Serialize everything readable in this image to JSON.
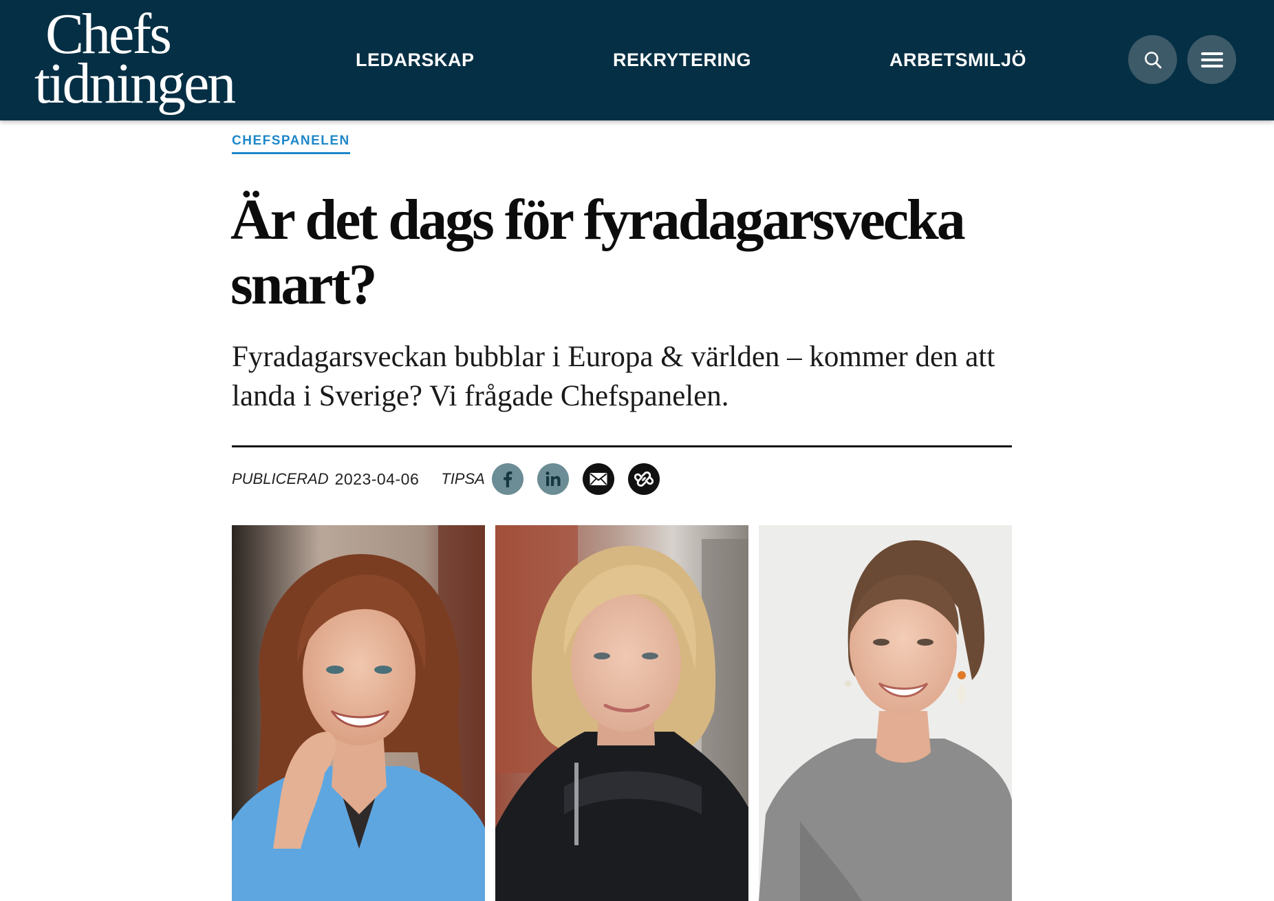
{
  "header": {
    "logo": {
      "line1": "Chefs",
      "line2": "tidningen"
    },
    "nav": [
      {
        "label": "LEDARSKAP"
      },
      {
        "label": "REKRYTERING"
      },
      {
        "label": "ARBETSMILJÖ"
      }
    ],
    "buttons": {
      "search_icon": "search-icon",
      "menu_icon": "hamburger-menu-icon"
    },
    "colors": {
      "background": "#052f44",
      "button": "#3d5a69"
    }
  },
  "article": {
    "category": "CHEFSPANELEN",
    "headline": "Är det dags för fyradagarsvecka snart?",
    "ingress": "Fyradagarsveckan bubblar i Europa & världen – kommer den att landa i Sverige? Vi frågade Chefspanelen.",
    "meta": {
      "published_label": "PUBLICERAD",
      "published_date": "2023-04-06",
      "share_label": "TIPSA",
      "share_buttons": [
        {
          "icon": "facebook-icon"
        },
        {
          "icon": "linkedin-icon"
        },
        {
          "icon": "mail-icon"
        },
        {
          "icon": "link-icon"
        }
      ]
    },
    "photos": [
      {
        "subject": "portrait-woman-blue-blazer"
      },
      {
        "subject": "portrait-woman-black-jacket"
      },
      {
        "subject": "portrait-woman-grey-sweater"
      }
    ],
    "colors": {
      "category": "#1d87c9",
      "social_share": "#6c8d95"
    }
  }
}
